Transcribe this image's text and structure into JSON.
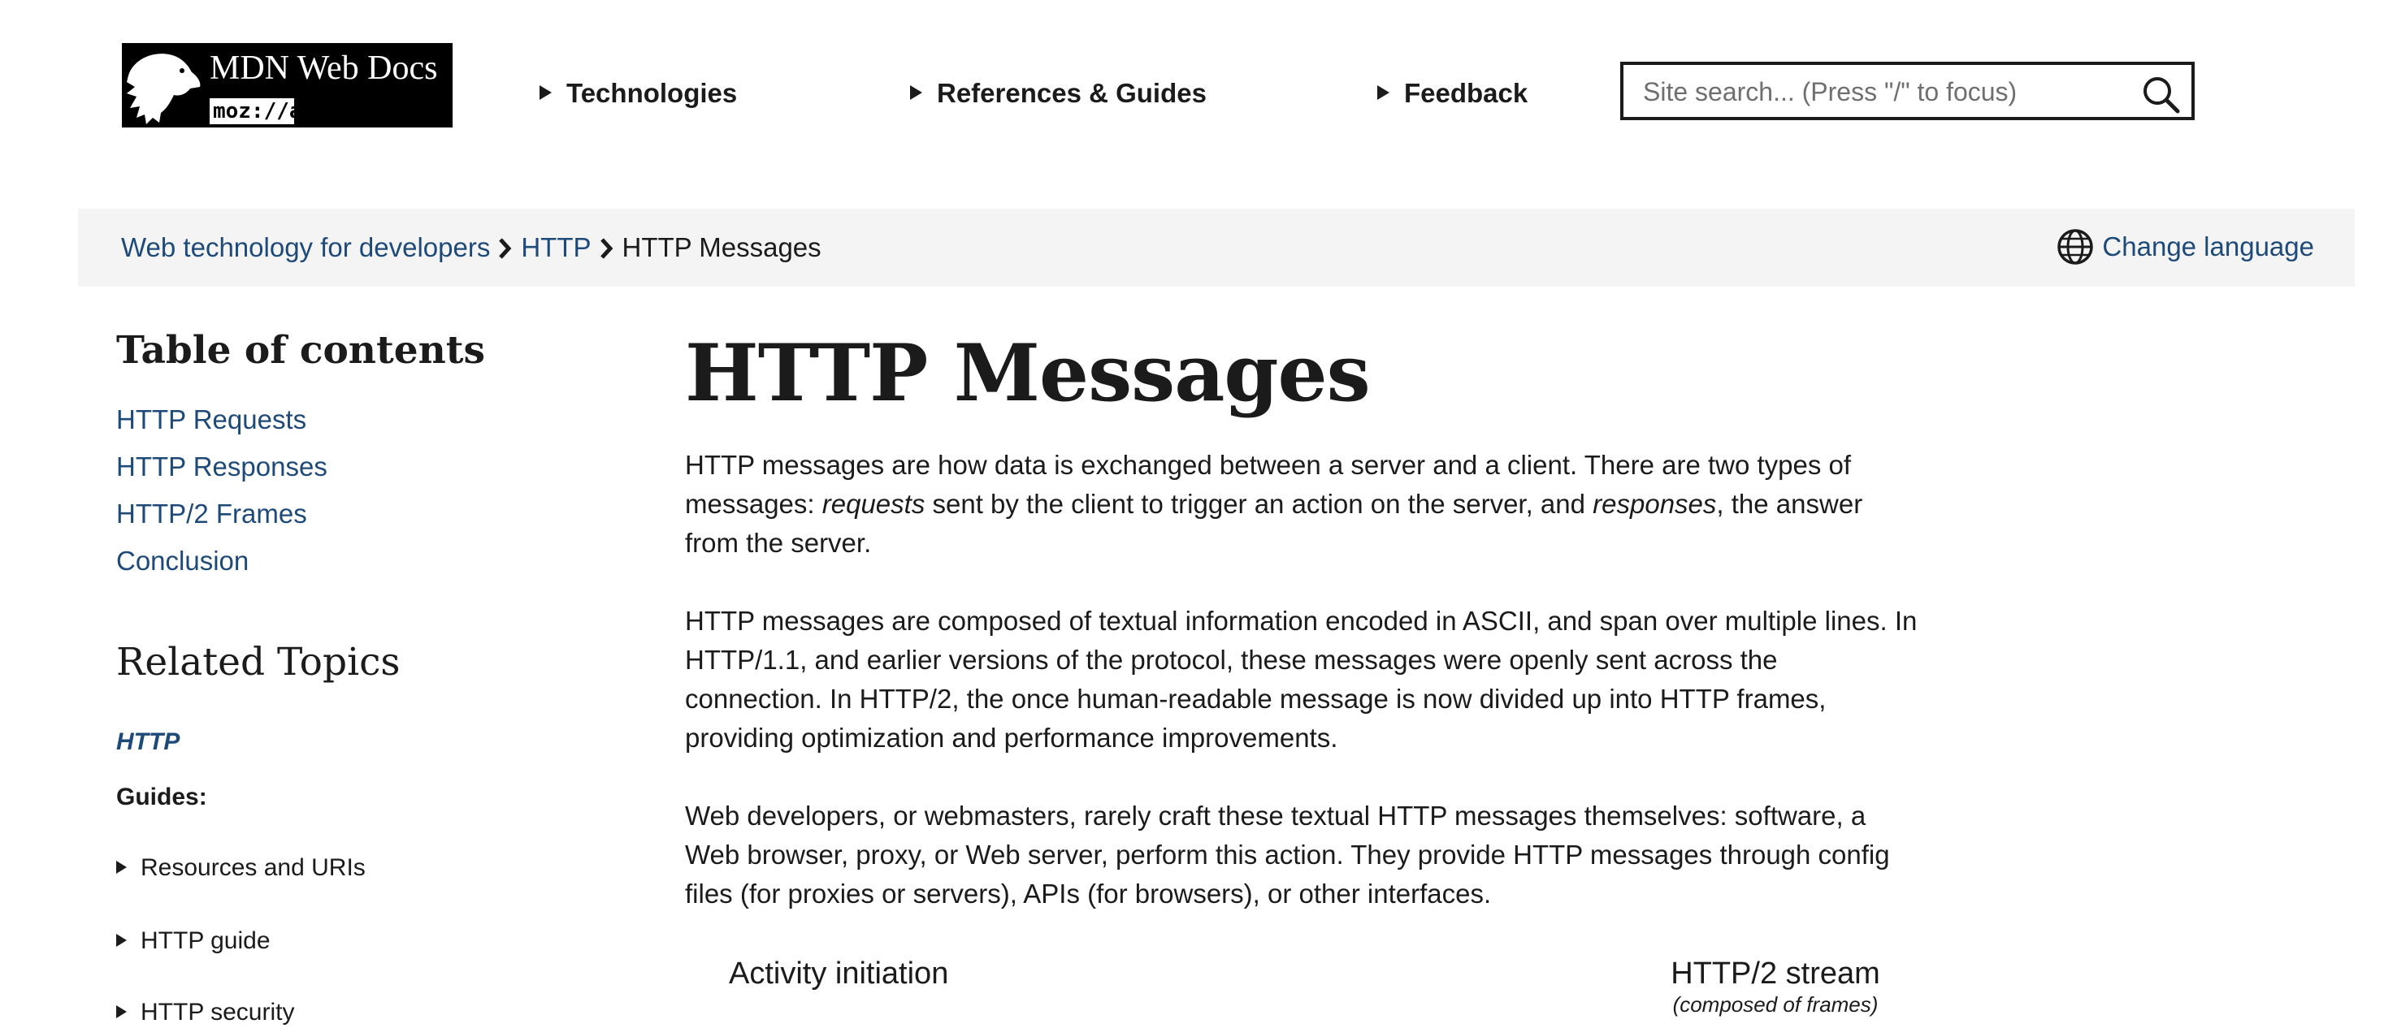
{
  "header": {
    "logo_title": "MDN Web Docs",
    "logo_sub": "moz://a",
    "nav": [
      "Technologies",
      "References & Guides",
      "Feedback"
    ],
    "search_placeholder": "Site search... (Press \"/\" to focus)"
  },
  "breadcrumb": {
    "items": [
      "Web technology for developers",
      "HTTP",
      "HTTP Messages"
    ],
    "change_language": "Change language"
  },
  "sidebar": {
    "toc_title": "Table of contents",
    "toc": [
      "HTTP Requests",
      "HTTP Responses",
      "HTTP/2 Frames",
      "Conclusion"
    ],
    "related_title": "Related Topics",
    "http_link": "HTTP",
    "guides_label": "Guides:",
    "guides": [
      "Resources and URIs",
      "HTTP guide",
      "HTTP security"
    ]
  },
  "main": {
    "title": "HTTP Messages",
    "p1_a": "HTTP messages are how data is exchanged between a server and a client. There are two types of messages: ",
    "p1_em1": "requests",
    "p1_b": " sent by the client to trigger an action on the server, and ",
    "p1_em2": "responses",
    "p1_c": ", the answer from the server.",
    "p2": "HTTP messages are composed of textual information encoded in ASCII, and span over multiple lines. In HTTP/1.1, and earlier versions of the protocol, these messages were openly sent across the connection. In HTTP/2, the once human-readable message is now divided up into HTTP frames, providing optimization and performance improvements.",
    "p3": "Web developers, or webmasters, rarely craft these textual HTTP messages themselves: software, a Web browser, proxy, or Web server, perform this action. They provide HTTP messages through config files (for proxies or servers), APIs (for browsers), or other interfaces.",
    "diagram_left": "Activity initiation",
    "diagram_right_title": "HTTP/2 stream",
    "diagram_right_sub": "(composed of frames)"
  },
  "colors": {
    "link": "#1e4a7a",
    "text": "#1b1b1b",
    "crumb_bg": "#f4f4f4"
  }
}
